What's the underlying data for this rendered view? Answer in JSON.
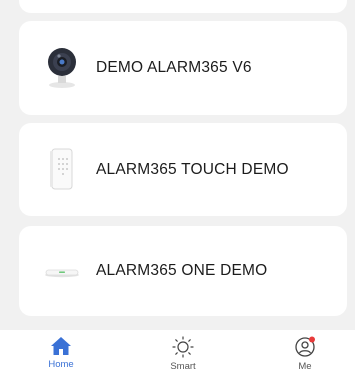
{
  "devices": [
    {
      "name": "DEMO ALARM365 V6",
      "thumb": "camera-device-icon"
    },
    {
      "name": "ALARM365 TOUCH DEMO",
      "thumb": "keypad-device-icon"
    },
    {
      "name": "ALARM365 ONE DEMO",
      "thumb": "hub-device-icon"
    }
  ],
  "tabbar": {
    "home_label": "Home",
    "smart_label": "Smart",
    "me_label": "Me",
    "active_color": "#3a71d6",
    "badge_color": "#e83a3a"
  }
}
